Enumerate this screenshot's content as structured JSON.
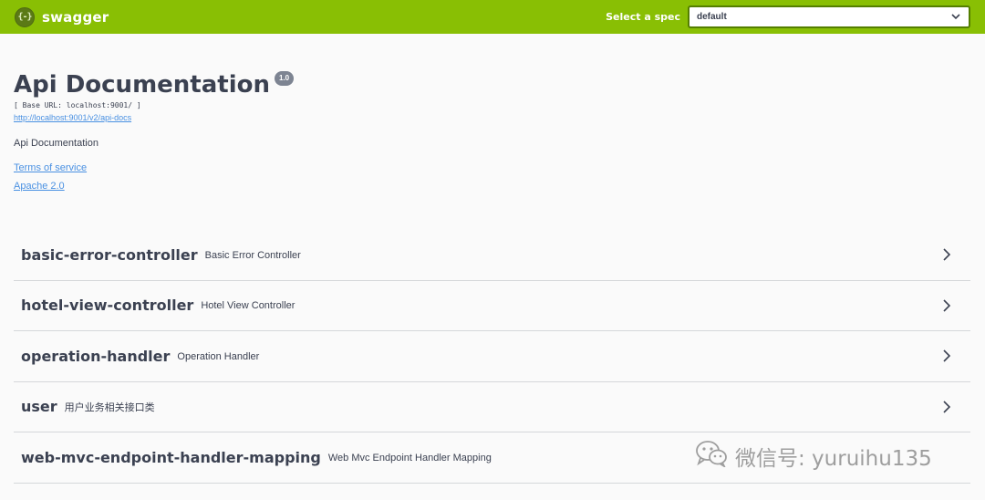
{
  "topbar": {
    "logo_glyph": "{-}",
    "logo_text": "swagger",
    "spec_label": "Select a spec",
    "spec_value": "default",
    "background": "#89bf04"
  },
  "info": {
    "title": "Api Documentation",
    "version": "1.0",
    "base_url": "[ Base URL: localhost:9001/ ]",
    "api_docs_url": "http://localhost:9001/v2/api-docs",
    "description": "Api Documentation",
    "terms_label": "Terms of service",
    "license_label": "Apache 2.0",
    "link_color": "#4990e2"
  },
  "tags": [
    {
      "name": "basic-error-controller",
      "description": "Basic Error Controller"
    },
    {
      "name": "hotel-view-controller",
      "description": "Hotel View Controller"
    },
    {
      "name": "operation-handler",
      "description": "Operation Handler"
    },
    {
      "name": "user",
      "description": "用户业务相关接口类"
    },
    {
      "name": "web-mvc-endpoint-handler-mapping",
      "description": "Web Mvc Endpoint Handler Mapping"
    }
  ],
  "watermark": {
    "text": "微信号: yuruihu135",
    "icon": "wechat-icon"
  }
}
